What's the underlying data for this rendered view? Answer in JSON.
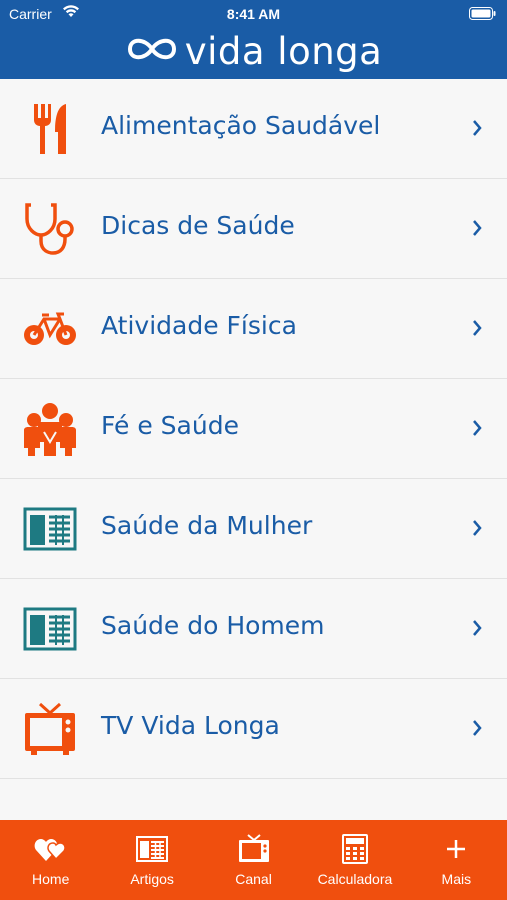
{
  "status_bar": {
    "carrier": "Carrier",
    "time": "8:41 AM"
  },
  "header": {
    "brand": "vida longa"
  },
  "menu": {
    "items": [
      {
        "label": "Alimentação Saudável",
        "icon": "fork-knife-icon"
      },
      {
        "label": "Dicas de Saúde",
        "icon": "stethoscope-icon"
      },
      {
        "label": "Atividade Física",
        "icon": "bicycle-icon"
      },
      {
        "label": "Fé e Saúde",
        "icon": "people-icon"
      },
      {
        "label": "Saúde da Mulher",
        "icon": "newspaper-icon"
      },
      {
        "label": "Saúde do Homem",
        "icon": "newspaper-icon"
      },
      {
        "label": "TV Vida Longa",
        "icon": "tv-icon"
      }
    ]
  },
  "tabbar": {
    "items": [
      {
        "label": "Home",
        "icon": "hearts-icon"
      },
      {
        "label": "Artigos",
        "icon": "newspaper-icon"
      },
      {
        "label": "Canal",
        "icon": "tv-icon"
      },
      {
        "label": "Calculadora",
        "icon": "calculator-icon"
      },
      {
        "label": "Mais",
        "icon": "plus-icon"
      }
    ]
  },
  "colors": {
    "header": "#1a5ca6",
    "accent": "#f04f0e",
    "teal": "#1e7a82",
    "label": "#1a5ca6"
  }
}
